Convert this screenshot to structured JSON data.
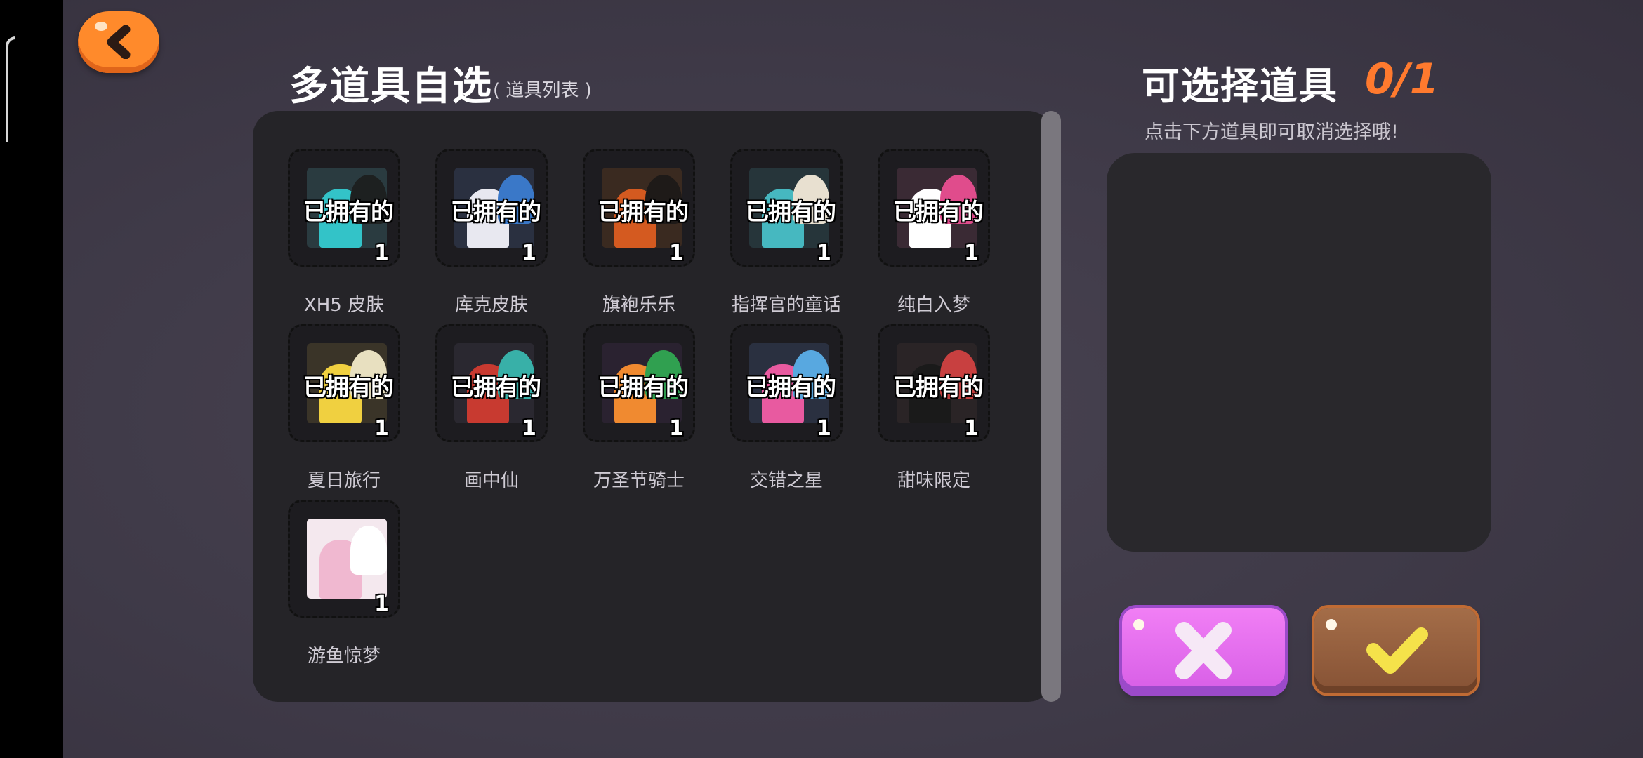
{
  "header": {
    "back_icon": "chevron-left-icon",
    "title": "多道具自选",
    "subtitle": "( 道具列表 )"
  },
  "items": [
    {
      "name": "XH5 皮肤",
      "owned": "已拥有的",
      "count": "1",
      "colors": [
        "#2a3b40",
        "#33c3c8",
        "#1d2020"
      ]
    },
    {
      "name": "库克皮肤",
      "owned": "已拥有的",
      "count": "1",
      "colors": [
        "#2a3040",
        "#e8e8f0",
        "#3a78c8"
      ]
    },
    {
      "name": "旗袍乐乐",
      "owned": "已拥有的",
      "count": "1",
      "colors": [
        "#3a2a20",
        "#d45a20",
        "#1e1a18"
      ]
    },
    {
      "name": "指挥官的童话",
      "owned": "已拥有的",
      "count": "1",
      "colors": [
        "#26353a",
        "#46b8c0",
        "#e8e0d0"
      ]
    },
    {
      "name": "纯白入梦",
      "owned": "已拥有的",
      "count": "1",
      "colors": [
        "#3a2a34",
        "#ffffff",
        "#e04c8c"
      ]
    },
    {
      "name": "夏日旅行",
      "owned": "已拥有的",
      "count": "1",
      "colors": [
        "#3a3428",
        "#f0d040",
        "#e8e0c0"
      ]
    },
    {
      "name": "画中仙",
      "owned": "已拥有的",
      "count": "1",
      "colors": [
        "#2a2830",
        "#c83a30",
        "#38b0a8"
      ]
    },
    {
      "name": "万圣节骑士",
      "owned": "已拥有的",
      "count": "1",
      "colors": [
        "#2a2230",
        "#f08a30",
        "#30a050"
      ]
    },
    {
      "name": "交错之星",
      "owned": "已拥有的",
      "count": "1",
      "colors": [
        "#2a3040",
        "#e85aa0",
        "#58a8e0"
      ]
    },
    {
      "name": "甜味限定",
      "owned": "已拥有的",
      "count": "1",
      "colors": [
        "#2a2426",
        "#1a1a1a",
        "#c84040"
      ]
    },
    {
      "name": "游鱼惊梦",
      "owned": "",
      "count": "1",
      "colors": [
        "#f4e8ee",
        "#f0b8d0",
        "#ffffff"
      ]
    }
  ],
  "selection": {
    "title": "可选择道具",
    "count": "0/1",
    "hint": "点击下方道具即可取消选择哦!"
  },
  "buttons": {
    "cancel_icon": "x-icon",
    "confirm_icon": "checkmark-icon",
    "cancel_color": "#e86ef0",
    "confirm_color": "#9a6342",
    "accent_orange": "#ff8a2b"
  }
}
